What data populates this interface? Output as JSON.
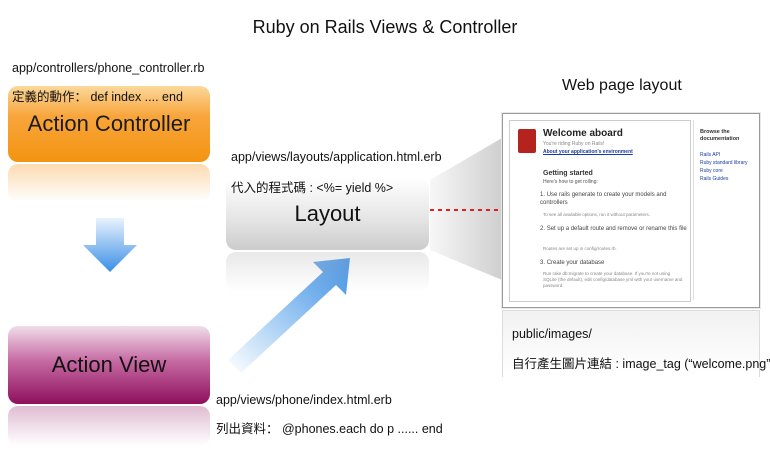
{
  "title": "Ruby on Rails Views & Controller",
  "controller": {
    "path": "app/controllers/phone_controller.rb",
    "note": "定義的動作： def index .... end",
    "label": "Action Controller"
  },
  "layout": {
    "path": "app/views/layouts/application.html.erb",
    "note": "代入的程式碼 : <%= yield %>",
    "label": "Layout"
  },
  "view": {
    "label": "Action View",
    "path": "app/views/phone/index.html.erb",
    "note": "列出資料： @phones.each do p ...... end"
  },
  "webpage": {
    "heading": "Web page layout",
    "images_path": "public/images/",
    "images_note": "自行產生圖片連結 : image_tag (“welcome.png”)",
    "screenshot": {
      "title": "Welcome aboard",
      "subtitle": "You're riding Ruby on Rails!",
      "env_link": "About your application's environment",
      "getting_started": "Getting started",
      "getting_started_sub": "Here's how to get rolling:",
      "steps": [
        {
          "num": "1.",
          "text": "Use rails generate to create your models and controllers",
          "sub": "To see all available options, run it without parameters."
        },
        {
          "num": "2.",
          "text": "Set up a default route and remove or rename this file",
          "sub": "Routes are set up in config/routes.rb."
        },
        {
          "num": "3.",
          "text": "Create your database",
          "sub": "Run rake db:migrate to create your database. If you're not using SQLite (the default), edit config/database.yml with your username and password."
        }
      ],
      "sidebar_heading": "Browse the documentation",
      "sidebar_links": [
        "Rails API",
        "Ruby standard library",
        "Ruby core",
        "Rails Guides"
      ]
    }
  },
  "colors": {
    "controller": "#f39411",
    "view": "#8e0f5d",
    "arrow_blue": "#3a8ee6",
    "dashed_arrow": "#e02020"
  }
}
